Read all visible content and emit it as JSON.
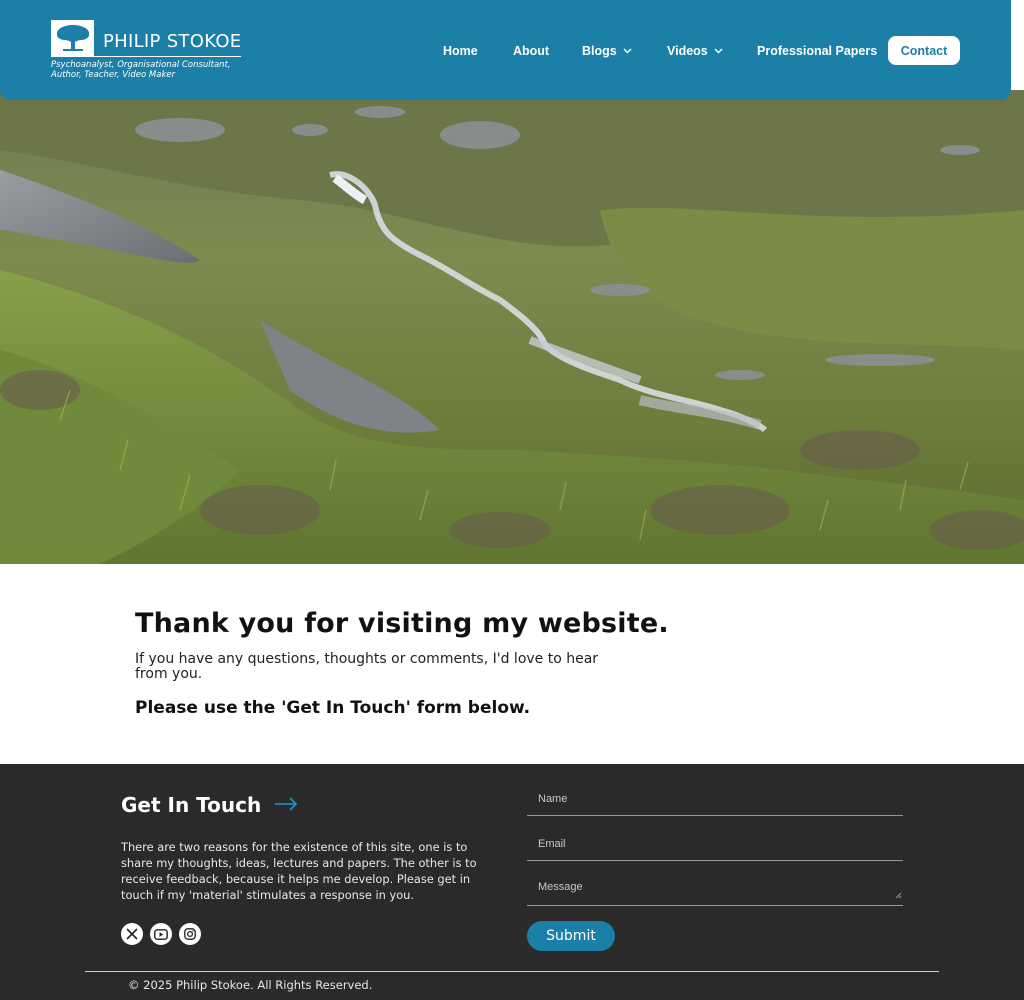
{
  "header": {
    "logo": {
      "name": "PHILIP STOKOE",
      "tagline": "Psychoanalyst, Organisational Consultant, Author, Teacher, Video Maker"
    },
    "nav": [
      {
        "label": "Home"
      },
      {
        "label": "About"
      },
      {
        "label": "Blogs",
        "has_dropdown": true
      },
      {
        "label": "Videos",
        "has_dropdown": true
      },
      {
        "label": "Professional Papers"
      }
    ],
    "contact_label": "Contact"
  },
  "hero": {
    "icon": "moorland-stream-landscape-photo"
  },
  "thanks": {
    "heading": "Thank you for visiting my website.",
    "body": "If you have any questions, thoughts or comments, I'd love to hear from you.",
    "cta": "Please use the 'Get In Touch' form below."
  },
  "footer": {
    "title": "Get In Touch",
    "description": "There are two reasons for the existence of this site, one is to share my thoughts, ideas, lectures and papers. The other is to receive feedback, because it helps me develop. Please get in touch if my 'material' stimulates a response in you.",
    "socials": [
      {
        "icon": "x-twitter-icon"
      },
      {
        "icon": "youtube-icon"
      },
      {
        "icon": "instagram-icon"
      }
    ],
    "form": {
      "name_placeholder": "Name",
      "email_placeholder": "Email",
      "message_placeholder": "Message",
      "submit_label": "Submit"
    },
    "copyright": "© 2025 Philip Stokoe. All Rights Reserved."
  },
  "colors": {
    "header_bg": "#1b7fa8",
    "footer_bg": "#2a2a2a",
    "accent": "#1b7fa8"
  }
}
